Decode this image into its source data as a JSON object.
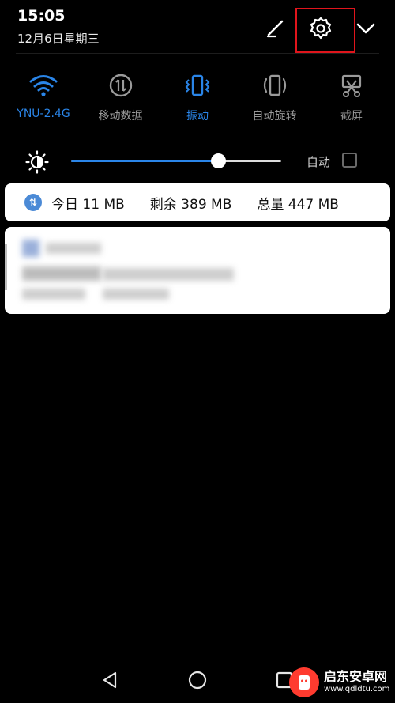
{
  "status": {
    "time": "15:05",
    "date": "12月6日星期三"
  },
  "header_icons": {
    "edit": "pencil-icon",
    "settings": "gear-icon",
    "expand": "chevron-down-icon"
  },
  "toggles": [
    {
      "label": "YNU-2.4G",
      "icon": "wifi-icon",
      "active": true
    },
    {
      "label": "移动数据",
      "icon": "mobile-data-icon",
      "active": false
    },
    {
      "label": "振动",
      "icon": "vibrate-icon",
      "active": true
    },
    {
      "label": "自动旋转",
      "icon": "auto-rotate-icon",
      "active": false
    },
    {
      "label": "截屏",
      "icon": "screenshot-icon",
      "active": false
    }
  ],
  "brightness": {
    "level_percent": 70,
    "auto_label": "自动",
    "auto_checked": false
  },
  "data_usage": {
    "today": "今日 11 MB",
    "remaining": "剩余 389 MB",
    "total": "总量 447 MB"
  },
  "navigation": {
    "back": "back-triangle-icon",
    "home": "home-circle-icon",
    "recent": "recent-square-icon"
  },
  "watermark": {
    "title": "启东安卓网",
    "url": "www.qdldtu.com"
  },
  "colors": {
    "accent": "#2a85e8",
    "highlight_frame": "#e0151c",
    "background": "#000000"
  }
}
